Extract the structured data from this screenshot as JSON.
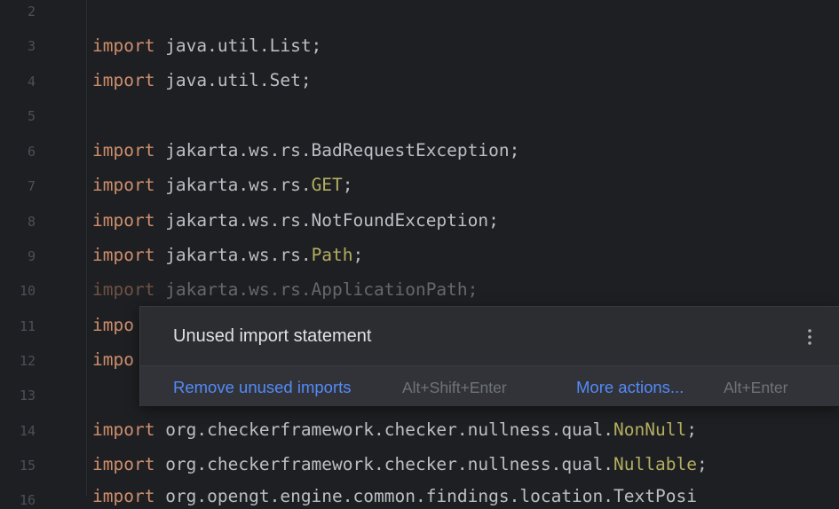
{
  "editor": {
    "lines": [
      {
        "num": "2",
        "kw": "",
        "rest": "",
        "ann": "",
        "tail": ""
      },
      {
        "num": "3",
        "kw": "import",
        "rest": " java.util.List;",
        "ann": "",
        "tail": ""
      },
      {
        "num": "4",
        "kw": "import",
        "rest": " java.util.Set;",
        "ann": "",
        "tail": ""
      },
      {
        "num": "5",
        "kw": "",
        "rest": "",
        "ann": "",
        "tail": ""
      },
      {
        "num": "6",
        "kw": "import",
        "rest": " jakarta.ws.rs.BadRequestException;",
        "ann": "",
        "tail": ""
      },
      {
        "num": "7",
        "kw": "import",
        "rest": " jakarta.ws.rs.",
        "ann": "GET",
        "tail": ";"
      },
      {
        "num": "8",
        "kw": "import",
        "rest": " jakarta.ws.rs.NotFoundException;",
        "ann": "",
        "tail": ""
      },
      {
        "num": "9",
        "kw": "import",
        "rest": " jakarta.ws.rs.",
        "ann": "Path",
        "tail": ";"
      },
      {
        "num": "10",
        "kw": "import",
        "rest": " jakarta.ws.rs.ApplicationPath;",
        "ann": "",
        "tail": ""
      },
      {
        "num": "11",
        "kw": "impo",
        "rest": "",
        "ann": "",
        "tail": ""
      },
      {
        "num": "12",
        "kw": "impo",
        "rest": "",
        "ann": "",
        "tail": ""
      },
      {
        "num": "13",
        "kw": "",
        "rest": "",
        "ann": "",
        "tail": ""
      },
      {
        "num": "14",
        "kw": "import",
        "rest": " org.checkerframework.checker.nullness.qual.",
        "ann": "NonNull",
        "tail": ";"
      },
      {
        "num": "15",
        "kw": "import",
        "rest": " org.checkerframework.checker.nullness.qual.",
        "ann": "Nullable",
        "tail": ";"
      },
      {
        "num": "16",
        "kw": "import",
        "rest": " org.opengt.engine.common.findings.location.TextPosi",
        "ann": "",
        "tail": ""
      }
    ]
  },
  "popup": {
    "title": "Unused import statement",
    "menu_icon": "more-vertical-icon",
    "primary_action": "Remove unused imports",
    "primary_shortcut": "Alt+Shift+Enter",
    "secondary_action": "More actions...",
    "secondary_shortcut": "Alt+Enter"
  }
}
